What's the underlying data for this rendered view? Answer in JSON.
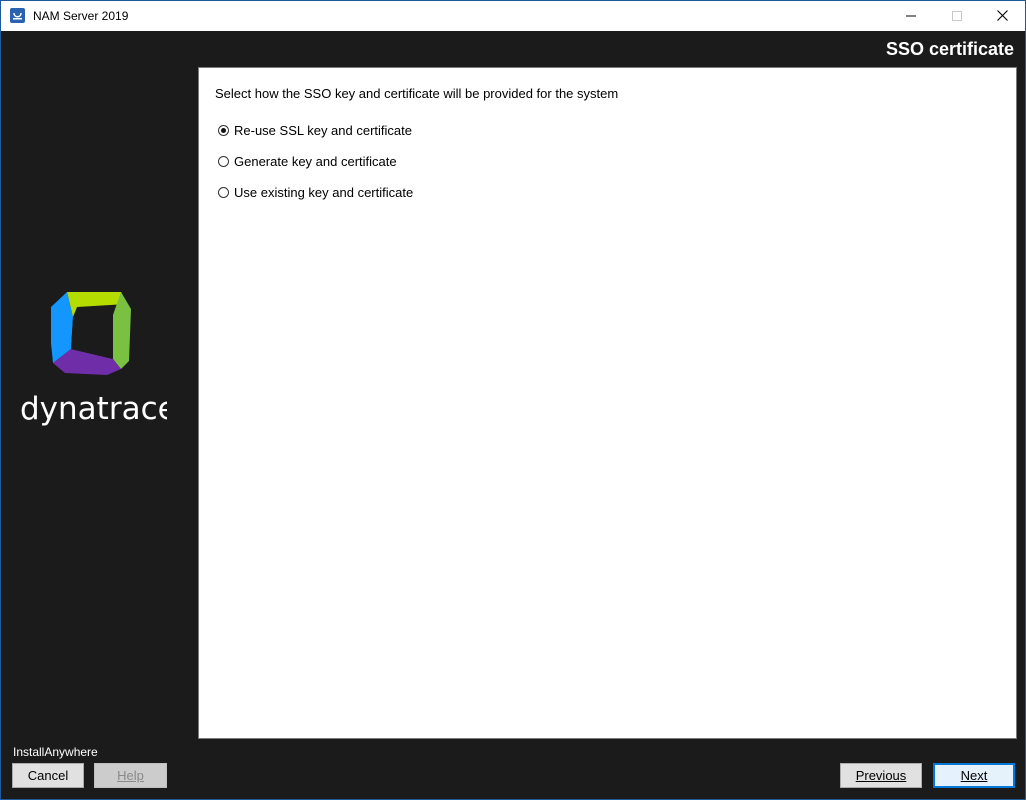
{
  "window": {
    "title": "NAM Server 2019",
    "controls": {
      "minimize": "minimize-icon",
      "maximize": "maximize-icon",
      "close": "close-icon"
    }
  },
  "header": {
    "title": "SSO certificate"
  },
  "sidebar": {
    "logo_text": "dynatrace"
  },
  "main": {
    "prompt": "Select how the SSO key and certificate will be provided for the system",
    "options": [
      {
        "label": "Re-use SSL key and certificate",
        "selected": true
      },
      {
        "label": "Generate key and certificate",
        "selected": false
      },
      {
        "label": "Use existing key and certificate",
        "selected": false
      }
    ]
  },
  "footer": {
    "brand": "InstallAnywhere",
    "buttons": {
      "cancel": "Cancel",
      "help": "Help",
      "previous": "Previous",
      "next": "Next"
    }
  },
  "colors": {
    "background": "#1b1b1b",
    "accent": "#0078d7",
    "logo_green": "#7ac142",
    "logo_lime": "#b4dc00",
    "logo_blue": "#1496ff",
    "logo_purple": "#6f2da8"
  }
}
